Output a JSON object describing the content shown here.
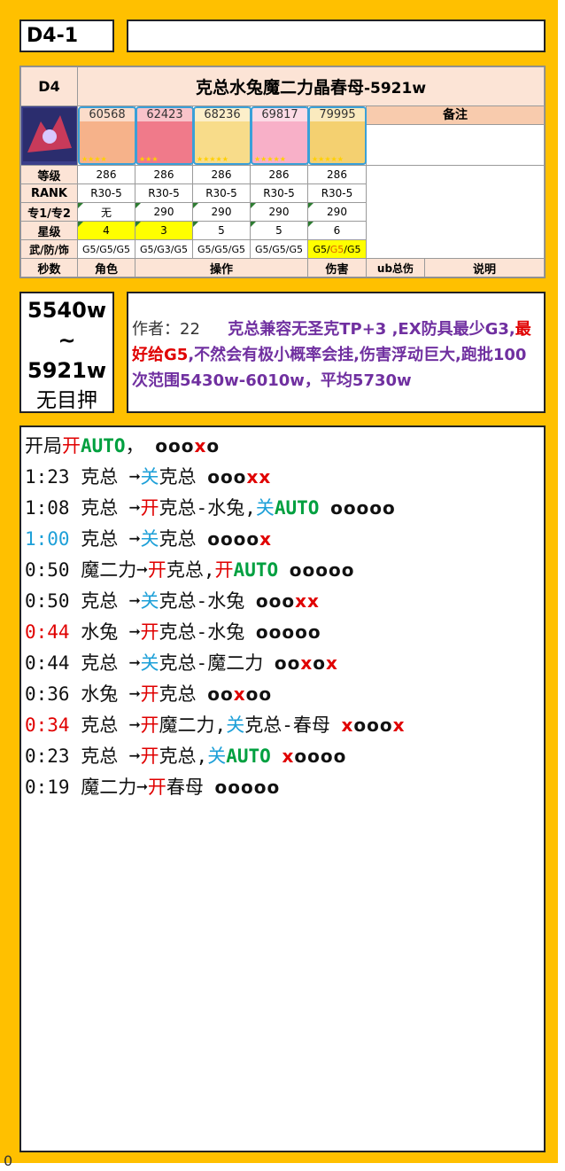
{
  "title": "D4-1",
  "team": {
    "stage": "D4",
    "name": "克总水兔魔二力晶春母",
    "damage_suffix": "-5921w",
    "remarks_label": "备注",
    "characters": [
      {
        "power": "60568",
        "level": "286",
        "rank": "R30-5",
        "ue": "无",
        "star": "4",
        "equip": "G5/G5/G5"
      },
      {
        "power": "62423",
        "level": "286",
        "rank": "R30-5",
        "ue": "290",
        "star": "3",
        "equip": "G5/G3/G5"
      },
      {
        "power": "68236",
        "level": "286",
        "rank": "R30-5",
        "ue": "290",
        "star": "5",
        "equip": "G5/G5/G5"
      },
      {
        "power": "69817",
        "level": "286",
        "rank": "R30-5",
        "ue": "290",
        "star": "5",
        "equip": "G5/G5/G5"
      },
      {
        "power": "79995",
        "level": "286",
        "rank": "R30-5",
        "ue": "290",
        "star": "6",
        "equip": "G5/G5/G5"
      }
    ],
    "row_labels": {
      "level": "等级",
      "rank": "RANK",
      "ue": "专1/专2",
      "star": "星级",
      "equip": "武/防/饰"
    },
    "footer": {
      "time": "秒数",
      "role": "角色",
      "action": "操作",
      "damage": "伤害",
      "ub_total": "ub总伤",
      "desc": "说明"
    }
  },
  "range": {
    "low": "5540w",
    "tilde": "~",
    "high": "5921w",
    "note": "无目押"
  },
  "note": {
    "author": "作者：22",
    "text1": "克总兼容无圣克TP+3 ,EX防具最少G3,",
    "text_red": "最好给G5",
    "text2": ",不然会有极小概率会挂,伤害浮动巨大,跑批100次范围5430w-6010w，平均5730w"
  },
  "ops": [
    {
      "time": "开局",
      "time_color": "",
      "segments": [
        {
          "t": "开",
          "c": "red"
        },
        {
          "t": "AUTO",
          "c": "green"
        },
        {
          "t": "，",
          "c": ""
        }
      ],
      "ub": [
        {
          "t": "ooo",
          "c": ""
        },
        {
          "t": "x",
          "c": "red"
        },
        {
          "t": "o",
          "c": ""
        }
      ]
    },
    {
      "time": "1:23",
      "time_color": "",
      "role": "克总",
      "segments": [
        {
          "t": "关",
          "c": "blue"
        },
        {
          "t": "克总",
          "c": ""
        }
      ],
      "ub": [
        {
          "t": "ooo",
          "c": ""
        },
        {
          "t": "xx",
          "c": "red"
        }
      ]
    },
    {
      "time": "1:08",
      "time_color": "",
      "role": "克总",
      "segments": [
        {
          "t": "开",
          "c": "red"
        },
        {
          "t": "克总-水兔,",
          "c": ""
        },
        {
          "t": "关",
          "c": "blue"
        },
        {
          "t": "AUTO",
          "c": "green"
        }
      ],
      "ub": [
        {
          "t": "ooooo",
          "c": ""
        }
      ]
    },
    {
      "time": "1:00",
      "time_color": "blue",
      "role": "克总",
      "segments": [
        {
          "t": "关",
          "c": "blue"
        },
        {
          "t": "克总",
          "c": ""
        }
      ],
      "ub": [
        {
          "t": "oooo",
          "c": ""
        },
        {
          "t": "x",
          "c": "red"
        }
      ]
    },
    {
      "time": "0:50",
      "time_color": "",
      "role": "魔二力",
      "segments": [
        {
          "t": "开",
          "c": "red"
        },
        {
          "t": "克总,",
          "c": ""
        },
        {
          "t": "开",
          "c": "red"
        },
        {
          "t": "AUTO",
          "c": "green"
        }
      ],
      "ub": [
        {
          "t": "ooooo",
          "c": ""
        }
      ]
    },
    {
      "time": "0:50",
      "time_color": "",
      "role": "克总",
      "segments": [
        {
          "t": "关",
          "c": "blue"
        },
        {
          "t": "克总-水兔",
          "c": ""
        }
      ],
      "ub": [
        {
          "t": "ooo",
          "c": ""
        },
        {
          "t": "xx",
          "c": "red"
        }
      ]
    },
    {
      "time": "0:44",
      "time_color": "red",
      "role": "水兔",
      "segments": [
        {
          "t": "开",
          "c": "red"
        },
        {
          "t": "克总-水兔",
          "c": ""
        }
      ],
      "ub": [
        {
          "t": "ooooo",
          "c": ""
        }
      ]
    },
    {
      "time": "0:44",
      "time_color": "",
      "role": "克总",
      "segments": [
        {
          "t": "关",
          "c": "blue"
        },
        {
          "t": "克总-魔二力",
          "c": ""
        }
      ],
      "ub": [
        {
          "t": "oo",
          "c": ""
        },
        {
          "t": "x",
          "c": "red"
        },
        {
          "t": "o",
          "c": ""
        },
        {
          "t": "x",
          "c": "red"
        }
      ]
    },
    {
      "time": "0:36",
      "time_color": "",
      "role": "水兔",
      "segments": [
        {
          "t": "开",
          "c": "red"
        },
        {
          "t": "克总",
          "c": ""
        }
      ],
      "ub": [
        {
          "t": "oo",
          "c": ""
        },
        {
          "t": "x",
          "c": "red"
        },
        {
          "t": "oo",
          "c": ""
        }
      ]
    },
    {
      "time": "0:34",
      "time_color": "red",
      "role": "克总",
      "segments": [
        {
          "t": "开",
          "c": "red"
        },
        {
          "t": "魔二力,",
          "c": ""
        },
        {
          "t": "关",
          "c": "blue"
        },
        {
          "t": "克总-春母",
          "c": ""
        }
      ],
      "ub": [
        {
          "t": "x",
          "c": "red"
        },
        {
          "t": "ooo",
          "c": ""
        },
        {
          "t": "x",
          "c": "red"
        }
      ]
    },
    {
      "time": "0:23",
      "time_color": "",
      "role": "克总",
      "segments": [
        {
          "t": "开",
          "c": "red"
        },
        {
          "t": "克总,",
          "c": ""
        },
        {
          "t": "关",
          "c": "blue"
        },
        {
          "t": "AUTO",
          "c": "green"
        }
      ],
      "ub": [
        {
          "t": "x",
          "c": "red"
        },
        {
          "t": "oooo",
          "c": ""
        }
      ]
    },
    {
      "time": "0:19",
      "time_color": "",
      "role": "魔二力",
      "segments": [
        {
          "t": "开",
          "c": "red"
        },
        {
          "t": "春母",
          "c": ""
        }
      ],
      "ub": [
        {
          "t": "ooooo",
          "c": ""
        }
      ]
    }
  ],
  "arrow": "➞",
  "footer_zero": "0"
}
